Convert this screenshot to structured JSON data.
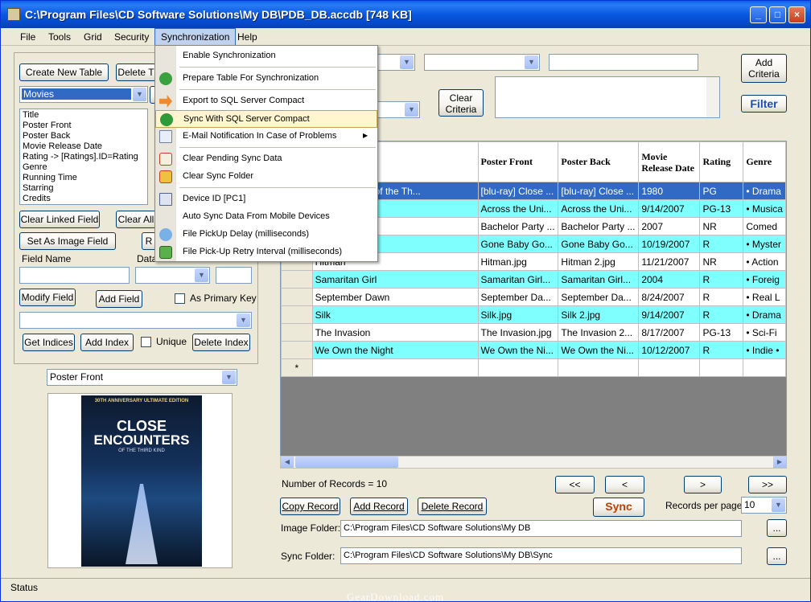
{
  "window": {
    "title": "C:\\Program Files\\CD Software Solutions\\My DB\\PDB_DB.accdb [748 KB]"
  },
  "menu": [
    "File",
    "Tools",
    "Grid",
    "Security",
    "Synchronization",
    "Help"
  ],
  "sync_menu": {
    "enable": "Enable Synchronization",
    "prepare": "Prepare Table For Synchronization",
    "export": "Export to SQL Server Compact",
    "sync": "Sync With SQL Server Compact",
    "email": "E-Mail Notification In Case of Problems",
    "clear_pending": "Clear Pending Sync Data",
    "clear_folder": "Clear Sync Folder",
    "device": "Device ID [PC1]",
    "auto": "Auto Sync Data From Mobile Devices",
    "pickup": "File PickUp Delay (milliseconds)",
    "retry": "File Pick-Up Retry Interval (milliseconds)"
  },
  "left": {
    "create_table": "Create New Table",
    "delete_table": "Delete T",
    "table_value": "Movies",
    "fields": [
      "Title",
      "Poster Front",
      "Poster Back",
      "Movie Release Date",
      "Rating -> [Ratings].ID=Rating",
      "Genre",
      "Running Time",
      "Starring",
      "Credits"
    ],
    "clear_linked": "Clear Linked Field",
    "clear_all": "Clear All",
    "set_image": "Set As Image Field",
    "r_btn": "R",
    "field_name": "Field Name",
    "data_type": "Data",
    "modify_field": "Modify Field",
    "add_field": "Add Field",
    "primary_key": "As Primary Key",
    "get_indices": "Get Indices",
    "add_index": "Add Index",
    "unique": "Unique",
    "delete_index": "Delete Index",
    "image_field": "Poster Front",
    "cover": {
      "top": "30TH ANNIVERSARY ULTIMATE EDITION",
      "title1": "CLOSE",
      "title2": "ENCOUNTERS",
      "sub": "OF THE THIRD KIND"
    }
  },
  "criteria": {
    "add": "Add Criteria",
    "clear": "Clear Criteria",
    "filter": "Filter"
  },
  "grid": {
    "headers": [
      "",
      "Poster Front",
      "Poster Back",
      "Movie Release Date",
      "Rating",
      "Genre"
    ],
    "rows": [
      [
        "e Encounters of the Th...",
        "[blu-ray] Close ...",
        "[blu-ray] Close ...",
        "1980",
        "PG",
        "• Drama"
      ],
      [
        "iverse",
        "Across the Uni...",
        "Across the Uni...",
        "9/14/2007",
        "PG-13",
        "• Musica"
      ],
      [
        "y 2",
        "Bachelor Party ...",
        "Bachelor Party ...",
        "2007",
        "NR",
        "Comed"
      ],
      [
        "one",
        "Gone Baby Go...",
        "Gone Baby Go...",
        "10/19/2007",
        "R",
        "• Myster"
      ],
      [
        "Hitman",
        "Hitman.jpg",
        "Hitman 2.jpg",
        "11/21/2007",
        "NR",
        "• Action"
      ],
      [
        "Samaritan Girl",
        "Samaritan Girl...",
        "Samaritan Girl...",
        "2004",
        "R",
        "• Foreig"
      ],
      [
        "September Dawn",
        "September Da...",
        "September Da...",
        "8/24/2007",
        "R",
        "• Real L"
      ],
      [
        "Silk",
        "Silk.jpg",
        "Silk 2.jpg",
        "9/14/2007",
        "R",
        "• Drama"
      ],
      [
        "The Invasion",
        "The Invasion.jpg",
        "The Invasion 2...",
        "8/17/2007",
        "PG-13",
        "• Sci-Fi"
      ],
      [
        "We Own the Night",
        "We Own the Ni...",
        "We Own the Ni...",
        "10/12/2007",
        "R",
        "• Indie •"
      ]
    ],
    "new_row_marker": "*"
  },
  "bottom": {
    "records": "Number of Records = 10",
    "nav": [
      "<<",
      "<",
      ">",
      ">>"
    ],
    "copy": "Copy Record",
    "add": "Add Record",
    "delete": "Delete Record",
    "sync": "Sync",
    "per_page_label": "Records per page:",
    "per_page": "10",
    "image_folder_label": "Image Folder:",
    "image_folder": "C:\\Program Files\\CD Software Solutions\\My DB",
    "sync_folder_label": "Sync Folder:",
    "sync_folder": "C:\\Program Files\\CD Software Solutions\\My DB\\Sync",
    "browse": "..."
  },
  "status": "Status",
  "watermark": "GearDownload.com"
}
